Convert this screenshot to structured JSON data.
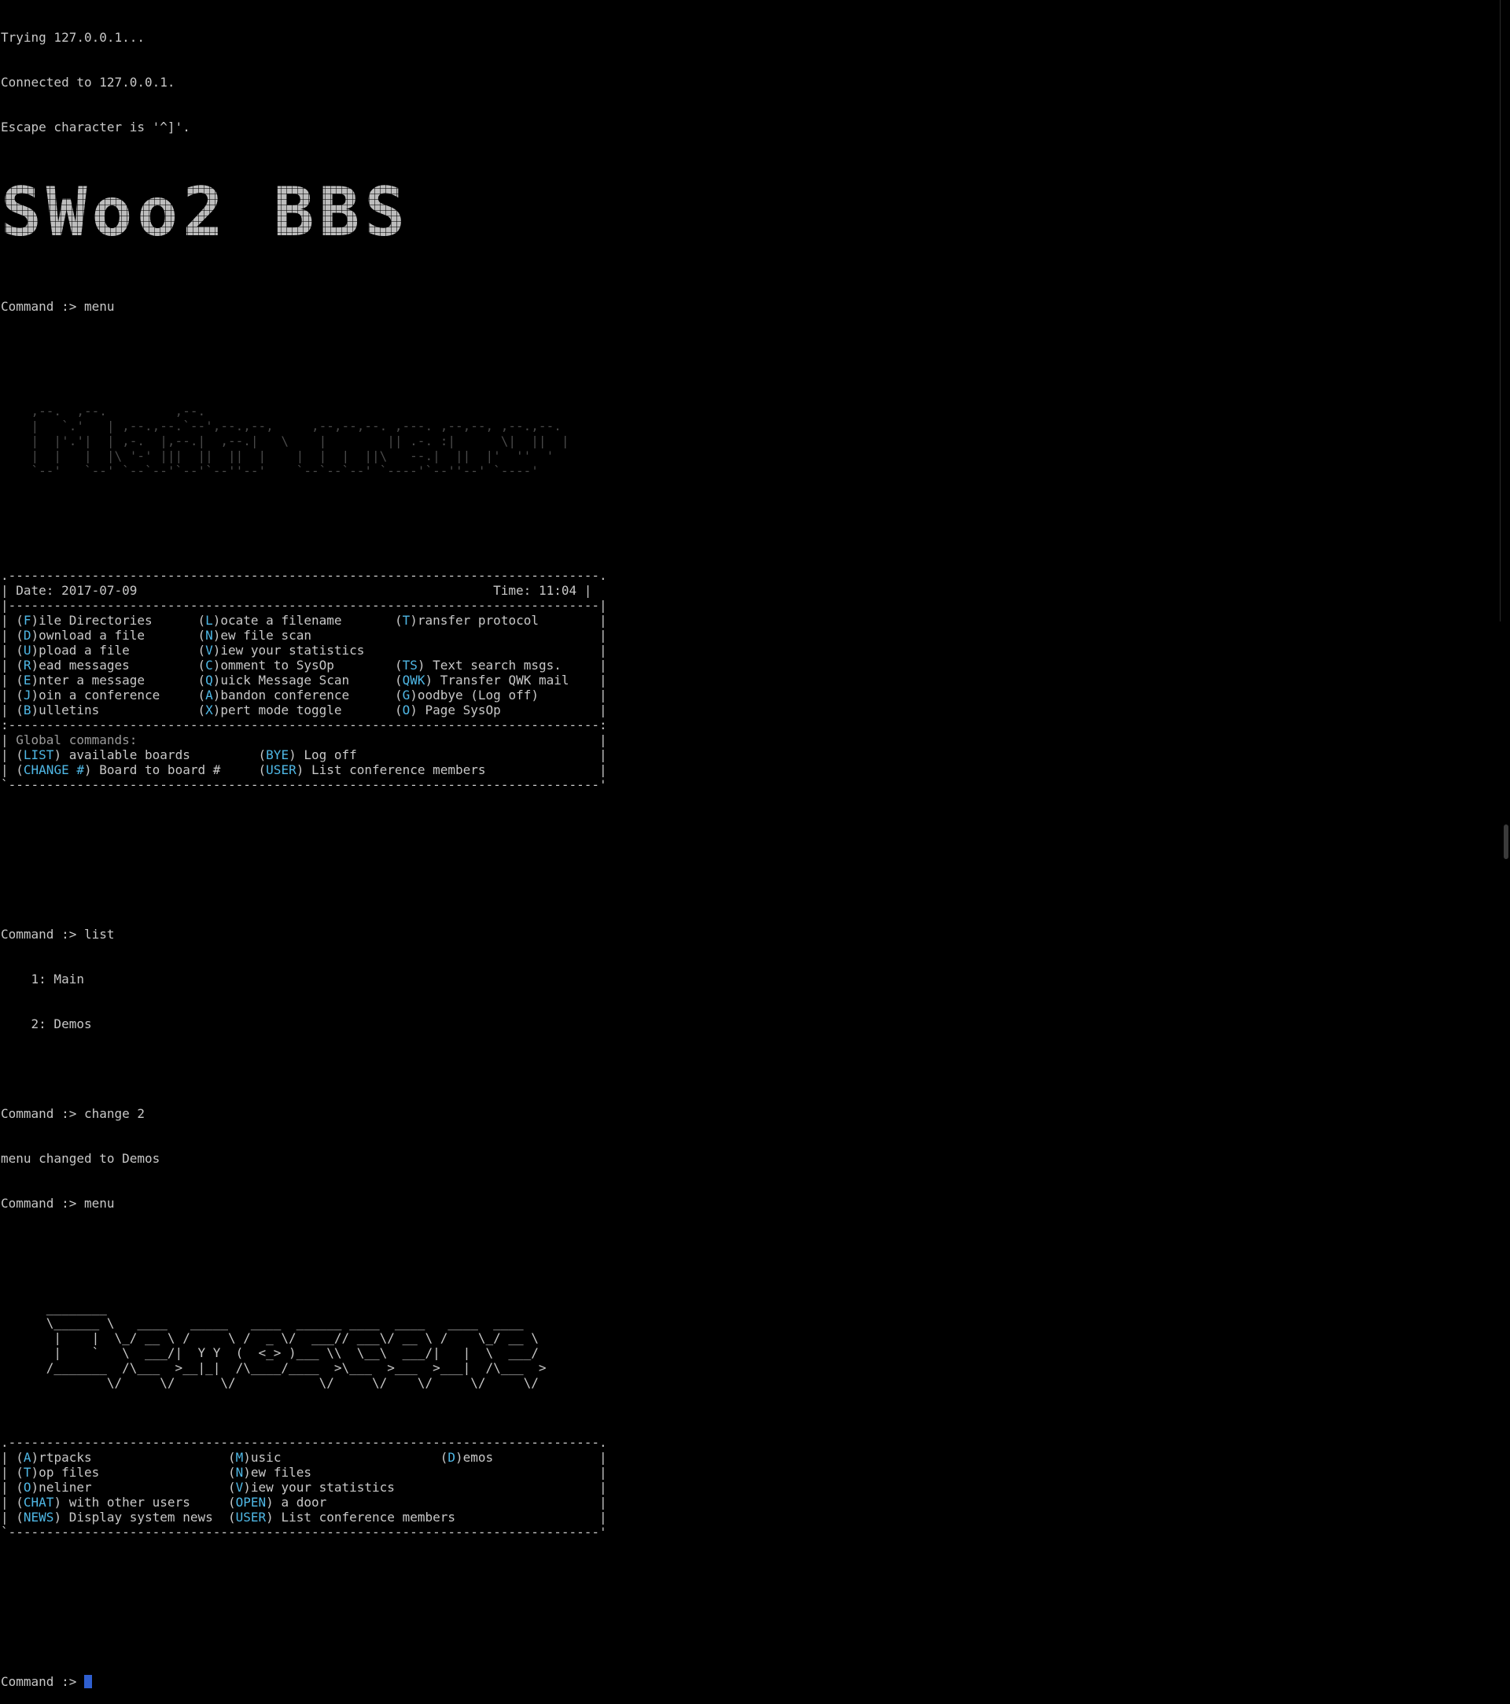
{
  "telnet": {
    "trying": "Trying 127.0.0.1...",
    "connected": "Connected to 127.0.0.1.",
    "escape": "Escape character is '^]'."
  },
  "banner": {
    "text": "SWoo2 BBS"
  },
  "session1": {
    "command": "Command :> menu"
  },
  "main_menu_art": [
    "    ,--.  ,--.         ,--.",
    "    |   `.'   | ,--.,--.`--',--.,--,     ,--,--,--. ,---. ,--,--, ,--.,--.",
    "    |  |'.'|  | ,-.  |,--.|  ,--.|   \\    |        || .-. :|      \\|  ||  |",
    "    |  |   |  |\\ '-' |||  ||  ||  |    |  |  |  ||\\   --.|  ||  |'  ''  '",
    "    `--'   `--' `--`--'`--'`--''--'    `--`--`--' `----'`--''--' `----'"
  ],
  "main_menu": {
    "border": ".------------------------------------------------------------------------------.",
    "mid_border": "|------------------------------------------------------------------------------|",
    "sep_border": ":------------------------------------------------------------------------------:",
    "bottom_border": "`------------------------------------------------------------------------------'",
    "date": "Date: 2017-07-09",
    "time": "Time: 11:04",
    "rows": [
      [
        [
          "(",
          "F",
          ")ile Directories      "
        ],
        [
          "(",
          "L",
          ")ocate a filename       "
        ],
        [
          "(",
          "T",
          ")ransfer protocol"
        ]
      ],
      [
        [
          "(",
          "D",
          ")ownload a file       "
        ],
        [
          "(",
          "N",
          ")ew file scan           "
        ],
        [
          "",
          "",
          ""
        ]
      ],
      [
        [
          "(",
          "U",
          ")pload a file         "
        ],
        [
          "(",
          "V",
          ")iew your statistics    "
        ],
        [
          "",
          "",
          ""
        ]
      ],
      [
        [
          "(",
          "R",
          ")ead messages         "
        ],
        [
          "(",
          "C",
          ")omment to SysOp        "
        ],
        [
          "(",
          "TS",
          ") Text search msgs."
        ]
      ],
      [
        [
          "(",
          "E",
          ")nter a message       "
        ],
        [
          "(",
          "Q",
          ")uick Message Scan      "
        ],
        [
          "(",
          "QWK",
          ") Transfer QWK mail"
        ]
      ],
      [
        [
          "(",
          "J",
          ")oin a conference     "
        ],
        [
          "(",
          "A",
          ")bandon conference      "
        ],
        [
          "(",
          "G",
          ")oodbye (Log off)"
        ]
      ],
      [
        [
          "(",
          "B",
          ")ulletins             "
        ],
        [
          "(",
          "X",
          ")pert mode toggle       "
        ],
        [
          "(",
          "O",
          ") Page SysOp"
        ]
      ]
    ],
    "global_label": "Global commands:",
    "global_rows": [
      [
        [
          "(",
          "LIST",
          ") available boards         "
        ],
        [
          "(",
          "BYE",
          ") Log off"
        ]
      ],
      [
        [
          "(",
          "CHANGE #",
          ") Board to board #     "
        ],
        [
          "(",
          "USER",
          ") List conference members"
        ]
      ]
    ]
  },
  "session2": {
    "command": "Command :> list",
    "boards": [
      "    1: Main",
      "    2: Demos"
    ],
    "change": "Command :> change 2",
    "changed": "menu changed to Demos",
    "menu": "Command :> menu"
  },
  "demos_art": [
    "      ________",
    "      \\______ \\   ____   _____   ____  ______ ____  ____   ____  ____",
    "       |    |  \\_/ __ \\ /     \\ /  _ \\/  ___// ___\\/ __ \\ /    \\_/ __ \\",
    "       |    `   \\  ___/|  Y Y  (  <_> )___ \\\\  \\__\\  ___/|   |  \\  ___/",
    "      /_______  /\\___  >__|_|  /\\____/____  >\\___  >___  >___|  /\\___  >",
    "              \\/     \\/      \\/           \\/     \\/    \\/     \\/     \\/"
  ],
  "demos_menu": {
    "border": ".------------------------------------------------------------------------------.",
    "bottom_border": "`------------------------------------------------------------------------------'",
    "rows": [
      [
        [
          "(",
          "A",
          ")rtpacks                  "
        ],
        [
          "(",
          "M",
          ")usic                     "
        ],
        [
          "(",
          "D",
          ")emos"
        ]
      ],
      [
        [
          "(",
          "T",
          ")op files                 "
        ],
        [
          "(",
          "N",
          ")ew files                 "
        ],
        [
          "",
          "",
          ""
        ]
      ],
      [
        [
          "(",
          "O",
          ")neliner                  "
        ],
        [
          "(",
          "V",
          ")iew your statistics      "
        ],
        [
          "",
          "",
          ""
        ]
      ],
      [
        [
          "(",
          "CHAT",
          ") with other users     "
        ],
        [
          "(",
          "OPEN",
          ") a door               "
        ],
        [
          "",
          "",
          ""
        ]
      ],
      [
        [
          "(",
          "NEWS",
          ") Display system news  "
        ],
        [
          "(",
          "USER",
          ") List conference members"
        ],
        [
          "",
          "",
          ""
        ]
      ]
    ]
  },
  "prompt": {
    "text": "Command :> "
  },
  "colors": {
    "hotkey": "#4fb8e6",
    "text": "#c8c8c8",
    "background": "#000000",
    "cursor": "#2f5fd0"
  }
}
